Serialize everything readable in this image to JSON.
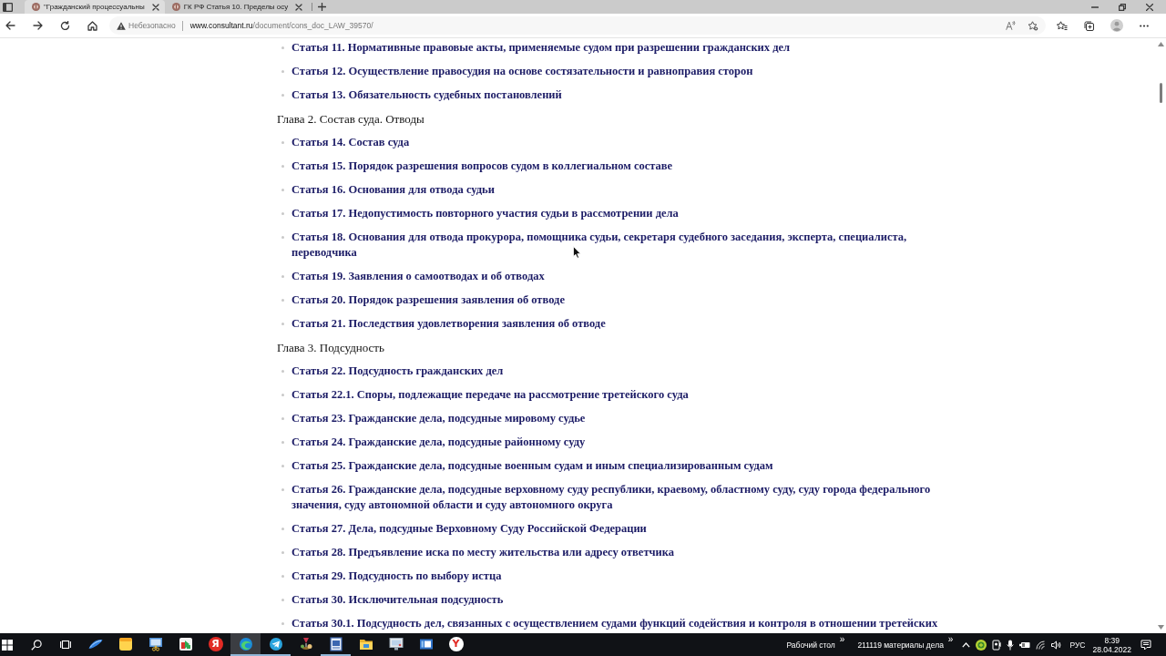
{
  "browser": {
    "tabs": [
      {
        "title": "\"Гражданский процессуальны",
        "selected": true
      },
      {
        "title": "ГК РФ Статья 10. Пределы осу",
        "selected": false
      }
    ],
    "address_bar": {
      "security": "Небезопасно",
      "url": "**www.consultant.ru**/document/cons_doc_LAW_39570/"
    }
  },
  "document": {
    "items": [
      {
        "kind": "article",
        "text": "Статья 11. Нормативные правовые акты, применяемые судом при разрешении гражданских дел"
      },
      {
        "kind": "article",
        "text": "Статья 12. Осуществление правосудия на основе состязательности и равноправия сторон"
      },
      {
        "kind": "article",
        "text": "Статья 13. Обязательность судебных постановлений"
      },
      {
        "kind": "chapter",
        "text": "Глава 2. Состав суда. Отводы"
      },
      {
        "kind": "article",
        "text": "Статья 14. Состав суда"
      },
      {
        "kind": "article",
        "text": "Статья 15. Порядок разрешения вопросов судом в коллегиальном составе"
      },
      {
        "kind": "article",
        "text": "Статья 16. Основания для отвода судьи"
      },
      {
        "kind": "article",
        "text": "Статья 17. Недопустимость повторного участия судьи в рассмотрении дела"
      },
      {
        "kind": "article",
        "text": "Статья 18. Основания для отвода прокурора, помощника судьи, секретаря судебного заседания, эксперта, специалиста, переводчика"
      },
      {
        "kind": "article",
        "text": "Статья 19. Заявления о самоотводах и об отводах"
      },
      {
        "kind": "article",
        "text": "Статья 20. Порядок разрешения заявления об отводе"
      },
      {
        "kind": "article",
        "text": "Статья 21. Последствия удовлетворения заявления об отводе"
      },
      {
        "kind": "chapter",
        "text": "Глава 3. Подсудность"
      },
      {
        "kind": "article",
        "text": "Статья 22. Подсудность гражданских дел"
      },
      {
        "kind": "article",
        "text": "Статья 22.1. Споры, подлежащие передаче на рассмотрение третейского суда"
      },
      {
        "kind": "article",
        "text": "Статья 23. Гражданские дела, подсудные мировому судье"
      },
      {
        "kind": "article",
        "text": "Статья 24. Гражданские дела, подсудные районному суду"
      },
      {
        "kind": "article",
        "text": "Статья 25. Гражданские дела, подсудные военным судам и иным специализированным судам"
      },
      {
        "kind": "article",
        "text": "Статья 26. Гражданские дела, подсудные верховному суду республики, краевому, областному суду, суду города федерального значения, суду автономной области и суду автономного округа"
      },
      {
        "kind": "article",
        "text": "Статья 27. Дела, подсудные Верховному Суду Российской Федерации"
      },
      {
        "kind": "article",
        "text": "Статья 28. Предъявление иска по месту жительства или адресу ответчика"
      },
      {
        "kind": "article",
        "text": "Статья 29. Подсудность по выбору истца"
      },
      {
        "kind": "article",
        "text": "Статья 30. Исключительная подсудность"
      },
      {
        "kind": "article",
        "text": "Статья 30.1. Подсудность дел, связанных с осуществлением судами функций содействия и контроля в отношении третейских"
      }
    ]
  },
  "taskbar": {
    "apps": [
      {
        "kind": "swoosh",
        "selected": false,
        "running": false
      },
      {
        "kind": "notes",
        "selected": false,
        "running": false
      },
      {
        "kind": "snipping",
        "selected": false,
        "running": false
      },
      {
        "kind": "arrow",
        "selected": false,
        "running": false
      },
      {
        "kind": "letter-red",
        "glyph": "Я",
        "selected": false,
        "running": false
      },
      {
        "kind": "swirl",
        "selected": true,
        "running": true
      },
      {
        "kind": "plane",
        "selected": false,
        "running": true
      },
      {
        "kind": "figure",
        "selected": false,
        "running": false
      },
      {
        "kind": "document",
        "selected": false,
        "running": true
      },
      {
        "kind": "folder",
        "selected": false,
        "running": false
      },
      {
        "kind": "monitor",
        "selected": false,
        "running": false
      },
      {
        "kind": "window",
        "selected": false,
        "running": false
      },
      {
        "kind": "letter-white",
        "glyph": "Y",
        "selected": false,
        "running": false
      }
    ],
    "toolbars": [
      {
        "label": "Рабочий стол",
        "chevron": "»"
      },
      {
        "label": "211119 материалы дела",
        "chevron": "»"
      }
    ],
    "language": "РУС",
    "time": "8:39",
    "date": "28.04.2022"
  }
}
